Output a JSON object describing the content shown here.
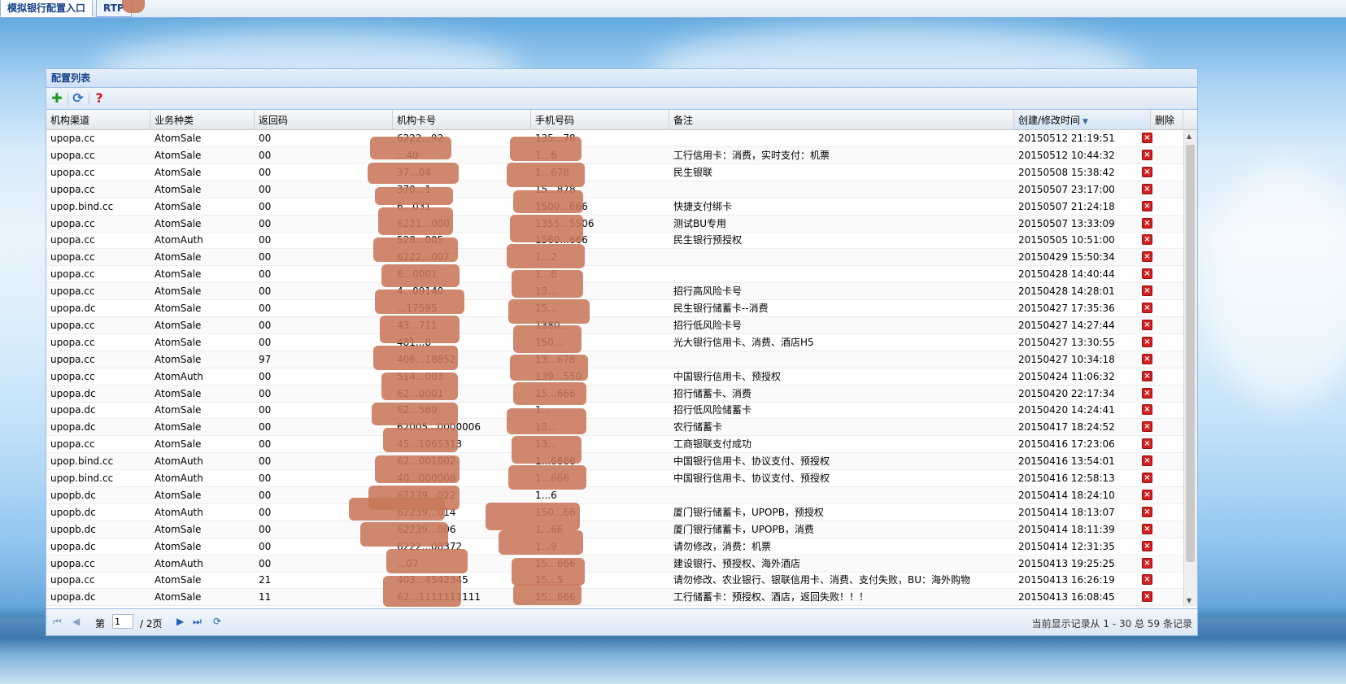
{
  "tabs": [
    {
      "label": "模拟银行配置入口",
      "active": true
    },
    {
      "label": "RTP",
      "active": false
    }
  ],
  "panel": {
    "title": "配置列表"
  },
  "toolbar": {
    "add_icon": "plus-icon",
    "refresh_icon": "refresh-icon",
    "help_icon": "help-icon"
  },
  "columns": [
    "机构渠道",
    "业务种类",
    "返回码",
    "机构卡号",
    "手机号码",
    "备注",
    "创建/修改时间",
    "删除"
  ],
  "rows": [
    {
      "channel": "upopa.cc",
      "type": "AtomSale",
      "code": "00",
      "card": "6222...92",
      "phone": "135...78",
      "remark": "",
      "time": "20150512 21:19:51"
    },
    {
      "channel": "upopa.cc",
      "type": "AtomSale",
      "code": "00",
      "card": "...40",
      "phone": "1...6",
      "remark": "工行信用卡：消费，实时支付：机票",
      "time": "20150512 10:44:32"
    },
    {
      "channel": "upopa.cc",
      "type": "AtomSale",
      "code": "00",
      "card": "37...04",
      "phone": "1...678",
      "remark": "民生银联",
      "time": "20150508 15:38:42"
    },
    {
      "channel": "upopa.cc",
      "type": "AtomSale",
      "code": "00",
      "card": "370...1",
      "phone": "15...878",
      "remark": "",
      "time": "20150507 23:17:00"
    },
    {
      "channel": "upop.bind.cc",
      "type": "AtomSale",
      "code": "00",
      "card": "6...031",
      "phone": "1500...666",
      "remark": "快捷支付绑卡",
      "time": "20150507 21:24:18"
    },
    {
      "channel": "upopa.cc",
      "type": "AtomSale",
      "code": "00",
      "card": "6221...000",
      "phone": "1355...5506",
      "remark": "测试BU专用",
      "time": "20150507 13:33:09"
    },
    {
      "channel": "upopa.cc",
      "type": "AtomAuth",
      "code": "00",
      "card": "528...005",
      "phone": "1560...666",
      "remark": "民生银行预授权",
      "time": "20150505 10:51:00"
    },
    {
      "channel": "upopa.cc",
      "type": "AtomSale",
      "code": "00",
      "card": "6222...007",
      "phone": "1...2",
      "remark": "",
      "time": "20150429 15:50:34"
    },
    {
      "channel": "upopa.cc",
      "type": "AtomSale",
      "code": "00",
      "card": "6...0001",
      "phone": "1...8",
      "remark": "",
      "time": "20150428 14:40:44"
    },
    {
      "channel": "upopa.cc",
      "type": "AtomSale",
      "code": "00",
      "card": "4...09140",
      "phone": "13...",
      "remark": "招行高风险卡号",
      "time": "20150428 14:28:01"
    },
    {
      "channel": "upopa.dc",
      "type": "AtomSale",
      "code": "00",
      "card": "...17595",
      "phone": "15...",
      "remark": "民生银行储蓄卡--消费",
      "time": "20150427 17:35:36"
    },
    {
      "channel": "upopa.cc",
      "type": "AtomSale",
      "code": "00",
      "card": "43...711",
      "phone": "1380...",
      "remark": "招行低风险卡号",
      "time": "20150427 14:27:44"
    },
    {
      "channel": "upopa.cc",
      "type": "AtomSale",
      "code": "00",
      "card": "481...8",
      "phone": "150...",
      "remark": "光大银行信用卡、消费、酒店H5",
      "time": "20150427 13:30:55"
    },
    {
      "channel": "upopa.cc",
      "type": "AtomSale",
      "code": "97",
      "card": "406...18852",
      "phone": "13...678",
      "remark": "",
      "time": "20150427 10:34:18"
    },
    {
      "channel": "upopa.cc",
      "type": "AtomAuth",
      "code": "00",
      "card": "514...003",
      "phone": "139...550",
      "remark": "中国银行信用卡、预授权",
      "time": "20150424 11:06:32"
    },
    {
      "channel": "upopa.dc",
      "type": "AtomSale",
      "code": "00",
      "card": "62...0001",
      "phone": "15...666",
      "remark": "招行储蓄卡、消费",
      "time": "20150420 22:17:34"
    },
    {
      "channel": "upopa.dc",
      "type": "AtomSale",
      "code": "00",
      "card": "62...569",
      "phone": "1...",
      "remark": "招行低风险储蓄卡",
      "time": "20150420 14:24:41"
    },
    {
      "channel": "upopa.dc",
      "type": "AtomSale",
      "code": "00",
      "card": "62005...0000006",
      "phone": "13...",
      "remark": "农行储蓄卡",
      "time": "20150417 18:24:52"
    },
    {
      "channel": "upopa.cc",
      "type": "AtomSale",
      "code": "00",
      "card": "45...1065313",
      "phone": "13...",
      "remark": "工商银联支付成功",
      "time": "20150416 17:23:06"
    },
    {
      "channel": "upop.bind.cc",
      "type": "AtomAuth",
      "code": "00",
      "card": "62...001002",
      "phone": "1...6666",
      "remark": "中国银行信用卡、协议支付、预授权",
      "time": "20150416 13:54:01"
    },
    {
      "channel": "upop.bind.cc",
      "type": "AtomAuth",
      "code": "00",
      "card": "40...000008",
      "phone": "1...666",
      "remark": "中国银行信用卡、协议支付、预授权",
      "time": "20150416 12:58:13"
    },
    {
      "channel": "upopb.dc",
      "type": "AtomSale",
      "code": "00",
      "card": "62239...022",
      "phone": "1...6",
      "remark": "",
      "time": "20150414 18:24:10"
    },
    {
      "channel": "upopb.dc",
      "type": "AtomAuth",
      "code": "00",
      "card": "62239...014",
      "phone": "150...66",
      "remark": "厦门银行储蓄卡，UPOPB，预授权",
      "time": "20150414 18:13:07"
    },
    {
      "channel": "upopb.dc",
      "type": "AtomSale",
      "code": "00",
      "card": "62239...006",
      "phone": "1...66",
      "remark": "厦门银行储蓄卡，UPOPB，消费",
      "time": "20150414 18:11:39"
    },
    {
      "channel": "upopa.dc",
      "type": "AtomSale",
      "code": "00",
      "card": "6222...08372",
      "phone": "1...9",
      "remark": "请勿修改，消费：机票",
      "time": "20150414 12:31:35"
    },
    {
      "channel": "upopa.cc",
      "type": "AtomAuth",
      "code": "00",
      "card": "...07",
      "phone": "15...666",
      "remark": "建设银行、预授权、海外酒店",
      "time": "20150413 19:25:25"
    },
    {
      "channel": "upopa.cc",
      "type": "AtomSale",
      "code": "21",
      "card": "403...4542345",
      "phone": "15...5",
      "remark": "请勿修改、农业银行、银联信用卡、消费、支付失败，BU：海外购物",
      "time": "20150413 16:26:19"
    },
    {
      "channel": "upopa.dc",
      "type": "AtomSale",
      "code": "11",
      "card": "62...1111111111",
      "phone": "15...666",
      "remark": "工行储蓄卡：预授权、酒店，返回失败！！！",
      "time": "20150413 16:08:45"
    }
  ],
  "pager": {
    "first_icon": "first-page-icon",
    "prev_icon": "prev-page-icon",
    "page_label": "第",
    "page_value": "1",
    "total_pages": "/ 2页",
    "next_icon": "next-page-icon",
    "last_icon": "last-page-icon",
    "refresh_icon": "refresh-icon",
    "info": "当前显示记录从 1 - 30 总 59 条记录"
  }
}
